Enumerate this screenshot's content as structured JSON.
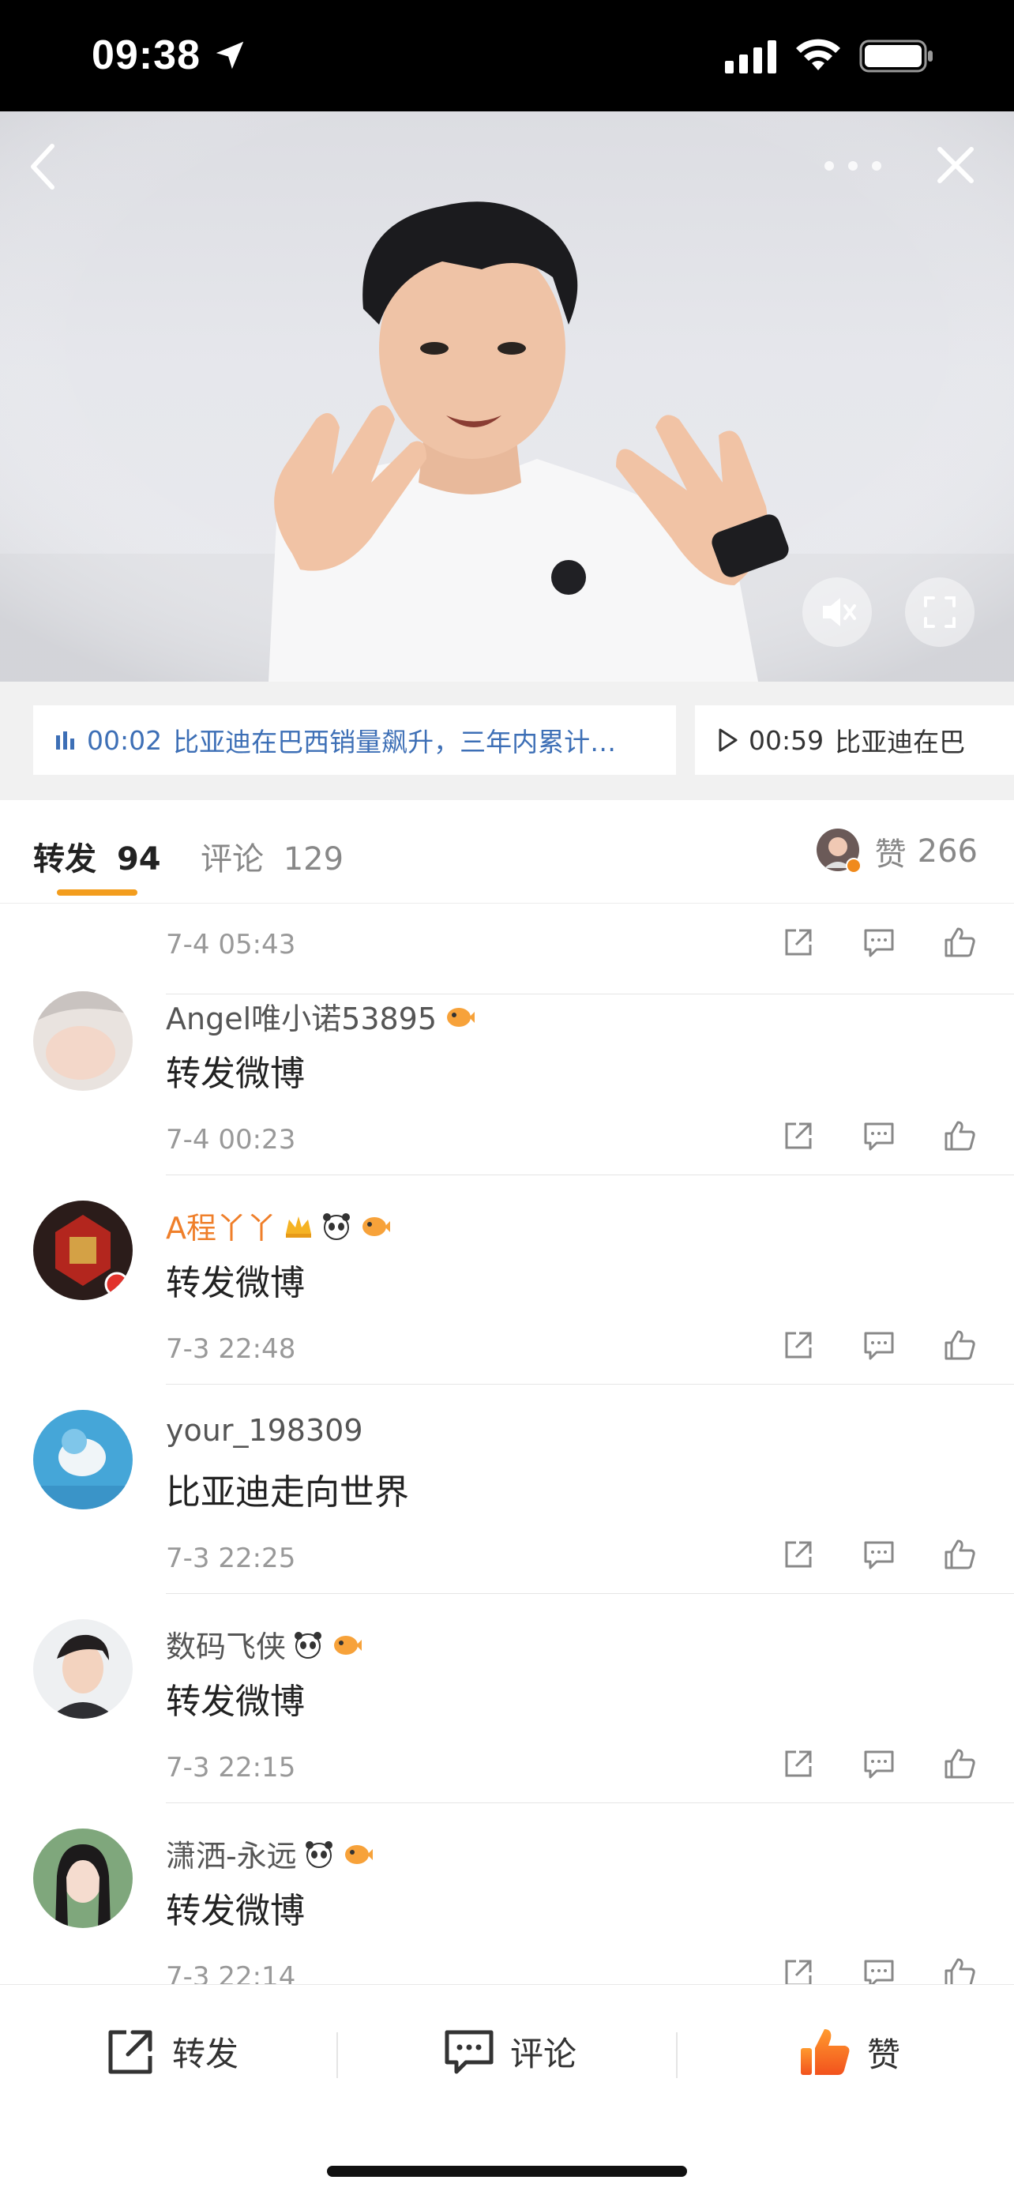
{
  "status": {
    "time": "09:38",
    "icons": [
      "location-arrow-icon",
      "cellular-signal-icon",
      "wifi-icon",
      "battery-icon"
    ]
  },
  "video": {
    "icons": [
      "back-icon",
      "more-icon",
      "close-icon",
      "mute-icon",
      "fullscreen-icon"
    ]
  },
  "chapters": [
    {
      "time": "00:02",
      "text": "比亚迪在巴西销量飙升，三年内累计…",
      "active": true
    },
    {
      "time": "00:59",
      "text": "比亚迪在巴",
      "active": false
    }
  ],
  "tabs": {
    "repost_label": "转发",
    "repost_count": "94",
    "comment_label": "评论",
    "comment_count": "129",
    "like_label": "赞",
    "like_count": "266"
  },
  "reposts": [
    {
      "user": "",
      "text": "",
      "time": "7-4 05:43"
    },
    {
      "user": "Angel唯小诺53895",
      "text": "转发微博",
      "time": "7-4 00:23",
      "badges": [
        "fish-emoji"
      ]
    },
    {
      "user": "A程丫丫",
      "text": "转发微博",
      "time": "7-3 22:48",
      "badges": [
        "crown-emoji",
        "panda-emoji",
        "fish-emoji"
      ],
      "highlight": true
    },
    {
      "user": "your_198309",
      "text": "比亚迪走向世界",
      "time": "7-3 22:25",
      "badges": []
    },
    {
      "user": "数码飞侠",
      "text": "转发微博",
      "time": "7-3 22:15",
      "badges": [
        "panda-emoji",
        "fish-emoji"
      ]
    },
    {
      "user": "潇洒-永远",
      "text": "转发微博",
      "time": "7-3 22:14",
      "badges": [
        "panda-emoji",
        "fish-emoji"
      ]
    }
  ],
  "bottom": {
    "repost_label": "转发",
    "comment_label": "评论",
    "like_label": "赞"
  },
  "colors": {
    "accent": "#f39d1d",
    "chapter_link": "#3d6fb6",
    "highlight_name": "#ef7f2a"
  }
}
